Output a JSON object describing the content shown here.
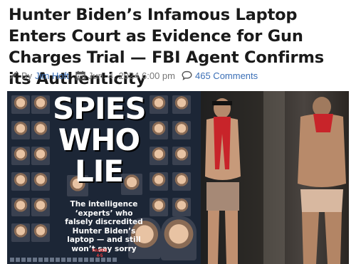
{
  "article": {
    "headline": "Hunter Biden’s Infamous Laptop Enters Court as Evidence for Gun Charges Trial — FBI Agent Confirms its Authenticity",
    "byline_prefix": "By",
    "author": "Jim Hoft",
    "date": "Jun. 4, 2024 6:00 pm",
    "comments": "465 Comments"
  },
  "icons": {
    "author": "pencil-icon",
    "date": "calendar-icon",
    "comments": "comment-bubble-icon"
  },
  "colors": {
    "headline": "#1a1a1a",
    "link": "#3b6fb6",
    "meta_text": "#777777",
    "cover_bg": "#1c2636",
    "pages_red": "#ff3b3b"
  },
  "cover": {
    "title_line1": "SPIES",
    "title_line2": "WHO",
    "title_line3": "LIE",
    "subtitle": "The intelligence ‘experts’ who falsely discredited Hunter Biden’s laptop — and still won’t say sorry",
    "pages_label": "PAGES 4-5"
  }
}
